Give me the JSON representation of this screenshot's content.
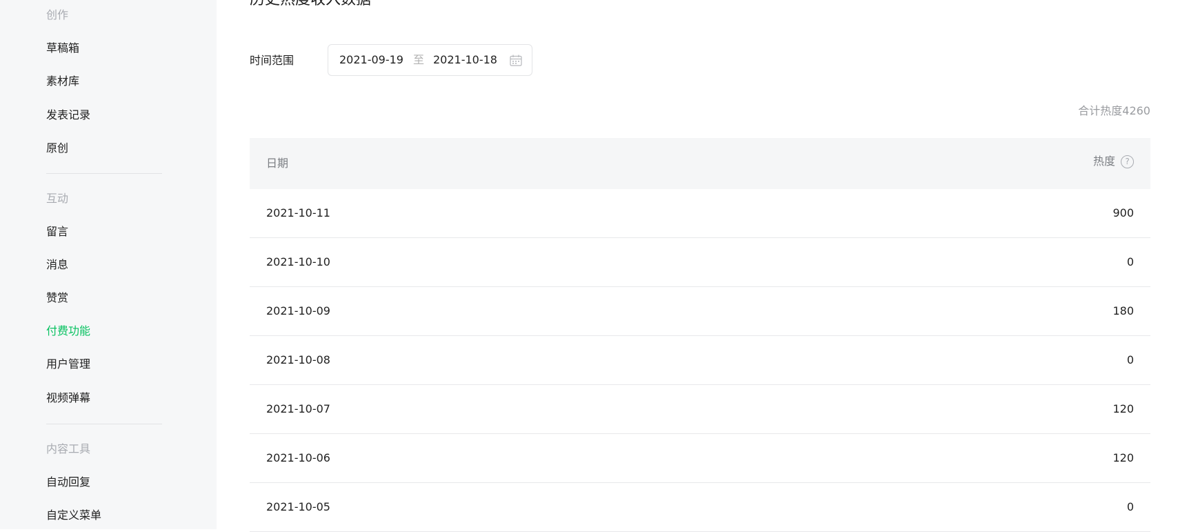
{
  "sidebar": {
    "sections": [
      {
        "title": "创作",
        "items": [
          "草稿箱",
          "素材库",
          "发表记录",
          "原创"
        ]
      },
      {
        "title": "互动",
        "items": [
          "留言",
          "消息",
          "赞赏",
          "付费功能",
          "用户管理",
          "视频弹幕"
        ]
      },
      {
        "title": "内容工具",
        "items": [
          "自动回复",
          "自定义菜单"
        ]
      }
    ],
    "active_item": "付费功能"
  },
  "main": {
    "title": "历史热度收入数据",
    "range_label": "时间范围",
    "date_range": {
      "start": "2021-09-19",
      "separator": "至",
      "end": "2021-10-18"
    },
    "total_label": "合计热度4260",
    "table": {
      "headers": {
        "date": "日期",
        "heat": "热度",
        "help_icon": "?"
      },
      "rows": [
        {
          "date": "2021-10-11",
          "heat": "900"
        },
        {
          "date": "2021-10-10",
          "heat": "0"
        },
        {
          "date": "2021-10-09",
          "heat": "180"
        },
        {
          "date": "2021-10-08",
          "heat": "0"
        },
        {
          "date": "2021-10-07",
          "heat": "120"
        },
        {
          "date": "2021-10-06",
          "heat": "120"
        },
        {
          "date": "2021-10-05",
          "heat": "0"
        }
      ]
    }
  },
  "colors": {
    "accent": "#07c160",
    "sidebar_bg": "#f6f7f8",
    "header_bg": "#f5f6f7"
  }
}
